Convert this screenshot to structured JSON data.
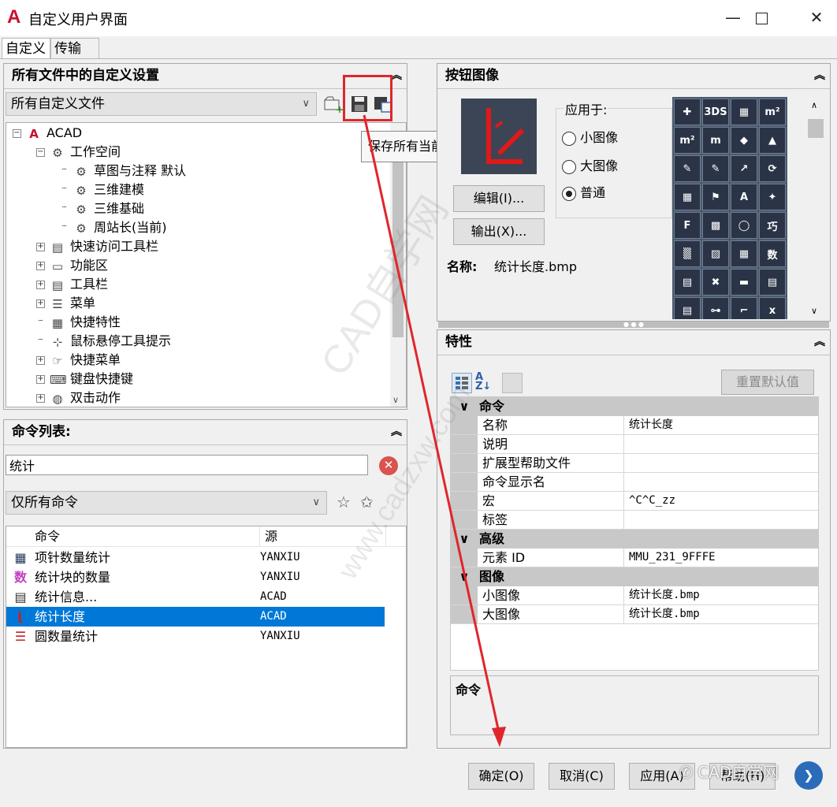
{
  "window": {
    "title": "自定义用户界面",
    "logo": "A"
  },
  "tabs": [
    "自定义",
    "传输"
  ],
  "customizations_panel": {
    "title": "所有文件中的自定义设置",
    "file_filter": "所有自定义文件",
    "tooltip": "保存所有当前自定义文件",
    "tree": [
      {
        "label": "ACAD",
        "level": 0,
        "icon": "autocad-logo-icon",
        "expander": "-"
      },
      {
        "label": "工作空间",
        "level": 1,
        "icon": "gear-icon",
        "expander": "-"
      },
      {
        "label": "草图与注释 默认",
        "level": 2,
        "icon": "gear-icon",
        "expander": ""
      },
      {
        "label": "三维建模",
        "level": 2,
        "icon": "gear-icon",
        "expander": ""
      },
      {
        "label": "三维基础",
        "level": 2,
        "icon": "gear-icon",
        "expander": ""
      },
      {
        "label": "周站长(当前)",
        "level": 2,
        "icon": "gear-icon",
        "expander": ""
      },
      {
        "label": "快速访问工具栏",
        "level": 1,
        "icon": "toolbar-icon",
        "expander": "+"
      },
      {
        "label": "功能区",
        "level": 1,
        "icon": "folder-icon",
        "expander": "+"
      },
      {
        "label": "工具栏",
        "level": 1,
        "icon": "toolbar-icon",
        "expander": "+"
      },
      {
        "label": "菜单",
        "level": 1,
        "icon": "menu-icon",
        "expander": "+"
      },
      {
        "label": "快捷特性",
        "level": 1,
        "icon": "quick-properties-icon",
        "expander": ""
      },
      {
        "label": "鼠标悬停工具提示",
        "level": 1,
        "icon": "rollover-tooltip-icon",
        "expander": ""
      },
      {
        "label": "快捷菜单",
        "level": 1,
        "icon": "shortcut-menu-icon",
        "expander": "+"
      },
      {
        "label": "键盘快捷键",
        "level": 1,
        "icon": "keyboard-icon",
        "expander": "+"
      },
      {
        "label": "双击动作",
        "level": 1,
        "icon": "mouse-icon",
        "expander": "+"
      }
    ]
  },
  "command_list_panel": {
    "title": "命令列表:",
    "search_value": "统计",
    "filter": "仅所有命令",
    "columns": [
      "命令",
      "源"
    ],
    "rows": [
      {
        "name": "项针数量统计",
        "source": "YANXIU",
        "icon": "grid-count-icon",
        "selected": false
      },
      {
        "name": "统计块的数量",
        "source": "YANXIU",
        "icon": "shu-character-icon",
        "selected": false
      },
      {
        "name": "统计信息...",
        "source": "ACAD",
        "icon": "statistics-info-icon",
        "selected": false
      },
      {
        "name": "统计长度",
        "source": "ACAD",
        "icon": "measure-length-icon",
        "selected": true
      },
      {
        "name": "圆数量统计",
        "source": "YANXIU",
        "icon": "circle-count-icon",
        "selected": false
      }
    ]
  },
  "button_image_panel": {
    "title": "按钮图像",
    "apply_to_label": "应用于:",
    "options": [
      {
        "label": "小图像",
        "checked": false
      },
      {
        "label": "大图像",
        "checked": false
      },
      {
        "label": "普通",
        "checked": true
      }
    ],
    "edit_button": "编辑(I)...",
    "export_button": "输出(X)...",
    "name_label": "名称:",
    "name_value": "统计长度.bmp",
    "icon_grid": [
      "✚",
      "3DS",
      "▦",
      "m²",
      "m²",
      "m",
      "◆",
      "▲",
      "✎",
      "✎",
      "↗",
      "⟳",
      "▦",
      "⚑",
      "A",
      "✦",
      "F",
      "▩",
      "◯",
      "巧",
      "▒",
      "▨",
      "▦",
      "数",
      "▤",
      "✖",
      "▬",
      "▤",
      "▤",
      "⊶",
      "⌐",
      "x"
    ]
  },
  "properties_panel": {
    "title": "特性",
    "reset_button": "重置默认值",
    "categories": [
      {
        "name": "命令",
        "rows": [
          {
            "key": "名称",
            "value": "统计长度"
          },
          {
            "key": "说明",
            "value": ""
          },
          {
            "key": "扩展型帮助文件",
            "value": ""
          },
          {
            "key": "命令显示名",
            "value": ""
          },
          {
            "key": "宏",
            "value": "^C^C_zz"
          },
          {
            "key": "标签",
            "value": ""
          }
        ]
      },
      {
        "name": "高级",
        "rows": [
          {
            "key": "元素 ID",
            "value": "MMU_231_9FFFE"
          }
        ]
      },
      {
        "name": "图像",
        "rows": [
          {
            "key": "小图像",
            "value": "统计长度.bmp"
          },
          {
            "key": "大图像",
            "value": "统计长度.bmp"
          }
        ]
      }
    ],
    "description_title": "命令"
  },
  "footer": {
    "ok": "确定(O)",
    "cancel": "取消(C)",
    "apply": "应用(A)",
    "help": "帮助(H)"
  },
  "watermark": {
    "main": "CAD自学网",
    "url": "www.cadzxw.com",
    "badge": "CAD自学网"
  },
  "annotation_color": "#e0262b"
}
